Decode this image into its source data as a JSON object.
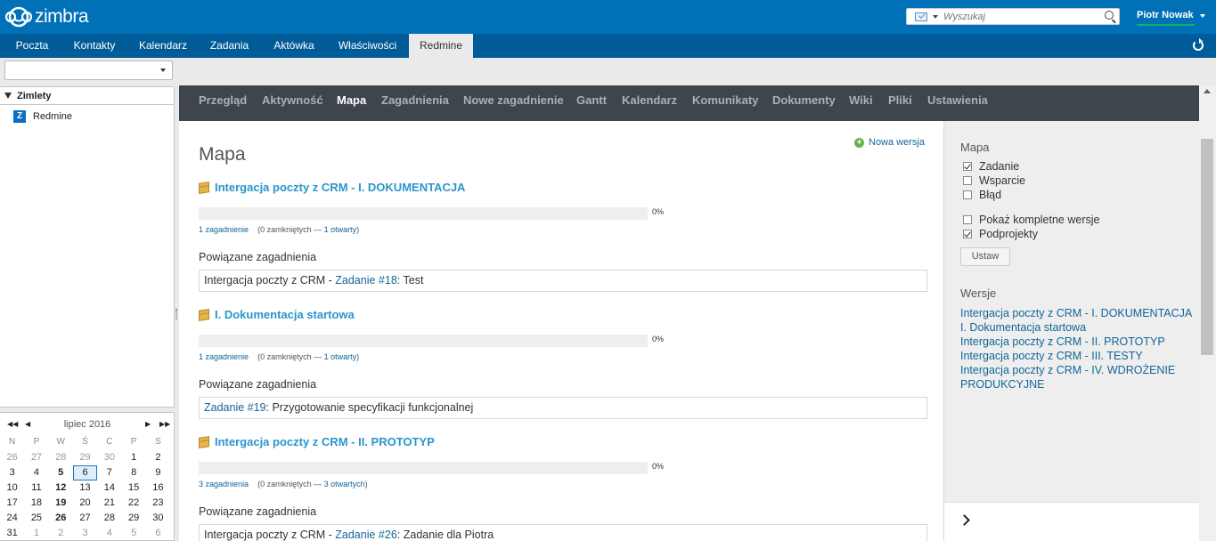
{
  "header": {
    "logo_text": "zimbra",
    "search_placeholder": "Wyszukaj",
    "user_name": "Piotr Nowak"
  },
  "app_tabs": [
    "Poczta",
    "Kontakty",
    "Kalendarz",
    "Zadania",
    "Aktówka",
    "Właściwości",
    "Redmine"
  ],
  "active_app_tab": "Redmine",
  "sidebar": {
    "zimlets_title": "Zimlety",
    "zimlet_icon_letter": "Z",
    "zimlet_item": "Redmine"
  },
  "calendar": {
    "month_label": "lipiec 2016",
    "days_of_week": [
      "N",
      "P",
      "W",
      "Ś",
      "C",
      "P",
      "S"
    ],
    "weeks": [
      [
        "26",
        "27",
        "28",
        "29",
        "30",
        "1",
        "2"
      ],
      [
        "3",
        "4",
        "5",
        "6",
        "7",
        "8",
        "9"
      ],
      [
        "10",
        "11",
        "12",
        "13",
        "14",
        "15",
        "16"
      ],
      [
        "17",
        "18",
        "19",
        "20",
        "21",
        "22",
        "23"
      ],
      [
        "24",
        "25",
        "26",
        "27",
        "28",
        "29",
        "30"
      ],
      [
        "31",
        "1",
        "2",
        "3",
        "4",
        "5",
        "6"
      ]
    ],
    "today": "6"
  },
  "redmine_menu": [
    "Przegląd",
    "Aktywność",
    "Mapa",
    "Zagadnienia",
    "Nowe zagadnienie",
    "Gantt",
    "Kalendarz",
    "Komunikaty",
    "Dokumenty",
    "Wiki",
    "Pliki",
    "Ustawienia"
  ],
  "active_redmine_tab": "Mapa",
  "main": {
    "title": "Mapa",
    "new_version_label": "Nowa wersja",
    "related_label": "Powiązane zagadnienia",
    "versions": [
      {
        "name": "Intergacja poczty z CRM - I. DOKUMENTACJA",
        "progress": 0,
        "progress_label": "0%",
        "issues_link": "1 zagadnienie",
        "closed_text": "(0 zamkniętych —",
        "open_link": "1 otwarty",
        "close_paren": ")",
        "related": [
          {
            "prefix": "Intergacja poczty z CRM - ",
            "link": "Zadanie #18",
            "suffix": ": Test"
          }
        ]
      },
      {
        "name": "I. Dokumentacja startowa",
        "progress": 0,
        "progress_label": "0%",
        "issues_link": "1 zagadnienie",
        "closed_text": "(0 zamkniętych —",
        "open_link": "1 otwarty",
        "close_paren": ")",
        "related": [
          {
            "prefix": "",
            "link": "Zadanie #19",
            "suffix": ": Przygotowanie specyfikacji funkcjonalnej"
          }
        ]
      },
      {
        "name": "Intergacja poczty z CRM - II. PROTOTYP",
        "progress": 0,
        "progress_label": "0%",
        "issues_link": "3 zagadnienia",
        "closed_text": "(0 zamkniętych —",
        "open_link": "3 otwartych",
        "close_paren": ")",
        "related": [
          {
            "prefix": "Intergacja poczty z CRM - ",
            "link": "Zadanie #26",
            "suffix": ": Zadanie dla Piotra"
          }
        ]
      }
    ]
  },
  "side": {
    "map_title": "Mapa",
    "trackers": [
      {
        "label": "Zadanie",
        "checked": true
      },
      {
        "label": "Wsparcie",
        "checked": false
      },
      {
        "label": "Błąd",
        "checked": false
      }
    ],
    "options": [
      {
        "label": "Pokaż kompletne wersje",
        "checked": false
      },
      {
        "label": "Podprojekty",
        "checked": true
      }
    ],
    "apply_label": "Ustaw",
    "versions_title": "Wersje",
    "version_links": [
      "Intergacja poczty z CRM - I. DOKUMENTACJA",
      "I. Dokumentacja startowa",
      "Intergacja poczty z CRM - II. PROTOTYP",
      "Intergacja poczty z CRM - III. TESTY",
      "Intergacja poczty z CRM - IV. WDROŻENIE PRODUKCYJNE"
    ]
  },
  "colors": {
    "header_bg": "#0070b7",
    "tabs_bg": "#005c98",
    "redmine_menu_bg": "#3e454c",
    "link": "#116699",
    "version_title": "#2996cc"
  }
}
